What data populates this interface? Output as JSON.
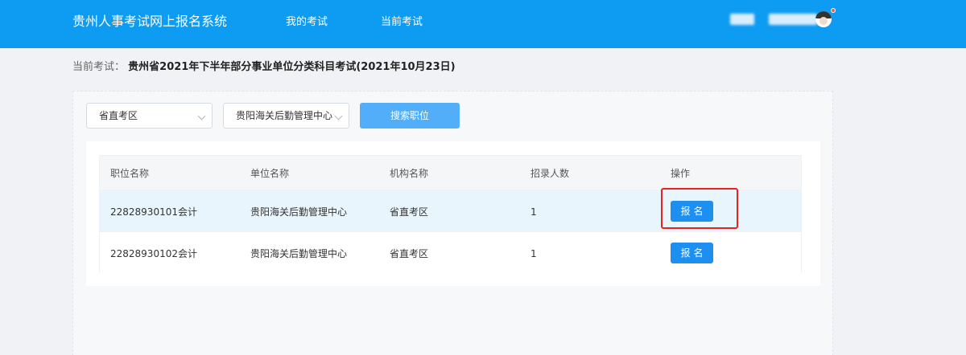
{
  "header": {
    "brand": "贵州人事考试网上报名系统",
    "nav": [
      "我的考试",
      "当前考试"
    ],
    "accent_color": "#0e9cf2",
    "avatar_icon": "user-avatar-icon"
  },
  "exam": {
    "label": "当前考试：",
    "name": "贵州省2021年下半年部分事业单位分类科目考试(2021年10月23日)"
  },
  "filters": {
    "region": "省直考区",
    "unit": "贵阳海关后勤管理中心",
    "search_label": "搜索职位"
  },
  "table": {
    "columns": [
      "职位名称",
      "单位名称",
      "机构名称",
      "招录人数",
      "操作"
    ],
    "rows": [
      {
        "position": "22828930101会计",
        "unit": "贵阳海关后勤管理中心",
        "org": "省直考区",
        "count": "1",
        "action": "报名"
      },
      {
        "position": "22828930102会计",
        "unit": "贵阳海关后勤管理中心",
        "org": "省直考区",
        "count": "1",
        "action": "报名"
      }
    ]
  },
  "colors": {
    "button": "#1c8ff0",
    "search_button": "#52aef8",
    "highlight": "#e82121",
    "selected_row": "#e8f5fd"
  }
}
